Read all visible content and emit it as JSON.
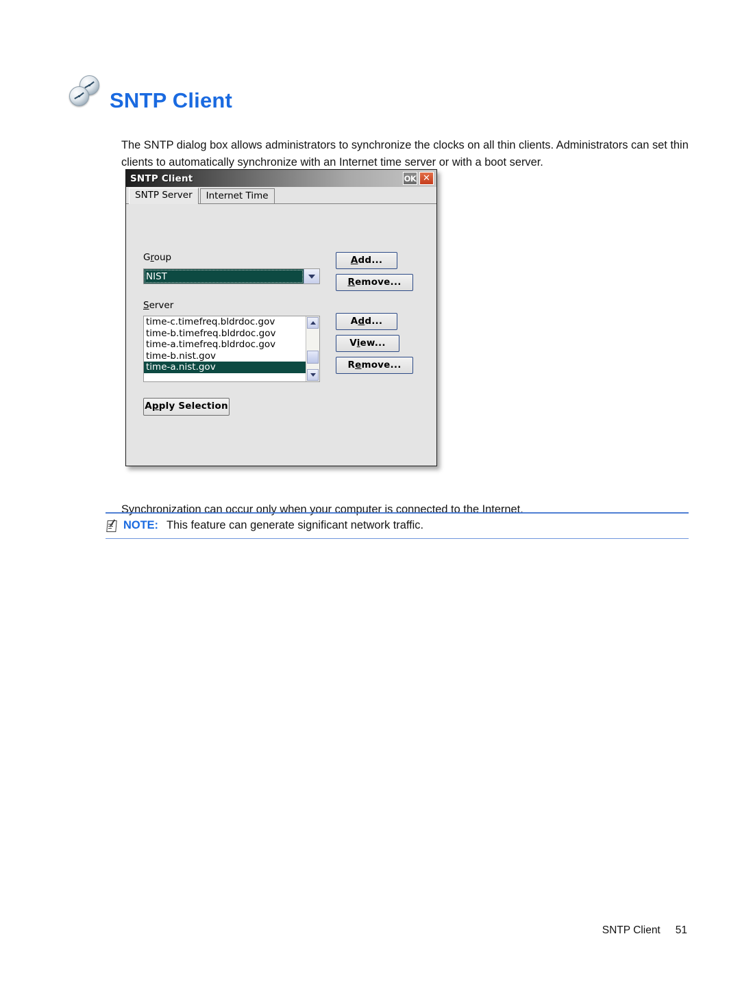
{
  "page": {
    "title": "SNTP Client",
    "logo_icon": "dual-clock-icon",
    "intro_paragraph": "The SNTP dialog box allows administrators to synchronize the clocks on all thin clients. Administrators can set thin clients to automatically synchronize with an Internet time server or with a boot server.",
    "sync_paragraph": "Synchronization can occur only when your computer is connected to the Internet."
  },
  "note": {
    "icon": "note-pencil-icon",
    "label": "NOTE:",
    "text": "This feature can generate significant network traffic.",
    "accent_color": "#4f7fd4"
  },
  "footer": {
    "chapter": "SNTP Client",
    "page_number": "51"
  },
  "dialog": {
    "titlebar": {
      "title": "SNTP Client",
      "ok_label": "OK",
      "close_label": "✕"
    },
    "tabs": [
      {
        "label": "SNTP Server",
        "active": true
      },
      {
        "label": "Internet Time",
        "active": false
      }
    ],
    "group": {
      "label_pre": "G",
      "label_accel": "r",
      "label_post": "oup",
      "label_full": "Group",
      "selected_value": "NIST",
      "dropdown_icon": "chevron-down-icon",
      "buttons": [
        {
          "id": "group-add",
          "accel": "A",
          "before": "",
          "after": "dd...",
          "label": "Add..."
        },
        {
          "id": "group-remove",
          "accel": "R",
          "before": "",
          "after": "emove...",
          "label": "Remove..."
        }
      ]
    },
    "server": {
      "label_accel": "S",
      "label_after": "erver",
      "label_full": "Server",
      "items": [
        {
          "text": "time-c.timefreq.bldrdoc.gov",
          "selected": false
        },
        {
          "text": "time-b.timefreq.bldrdoc.gov",
          "selected": false
        },
        {
          "text": "time-a.timefreq.bldrdoc.gov",
          "selected": false
        },
        {
          "text": "time-b.nist.gov",
          "selected": false
        },
        {
          "text": "time-a.nist.gov",
          "selected": true
        }
      ],
      "buttons": [
        {
          "id": "server-add",
          "before": "A",
          "accel": "d",
          "after": "d...",
          "label": "Add..."
        },
        {
          "id": "server-view",
          "before": "V",
          "accel": "i",
          "after": "ew...",
          "label": "View..."
        },
        {
          "id": "server-remove",
          "before": "R",
          "accel": "e",
          "after": "move...",
          "label": "Remove..."
        }
      ],
      "scrollbar": {
        "up_icon": "scroll-up-arrow-icon",
        "down_icon": "scroll-down-arrow-icon"
      }
    },
    "apply_button": {
      "before": "A",
      "accel": "p",
      "after": "ply Selection",
      "label": "Apply Selection"
    },
    "colors": {
      "selection": "#0d4a42",
      "dialog_bg": "#e4e4e4",
      "button_border": "#2c4a86",
      "close_button": "#c53b1b"
    }
  }
}
